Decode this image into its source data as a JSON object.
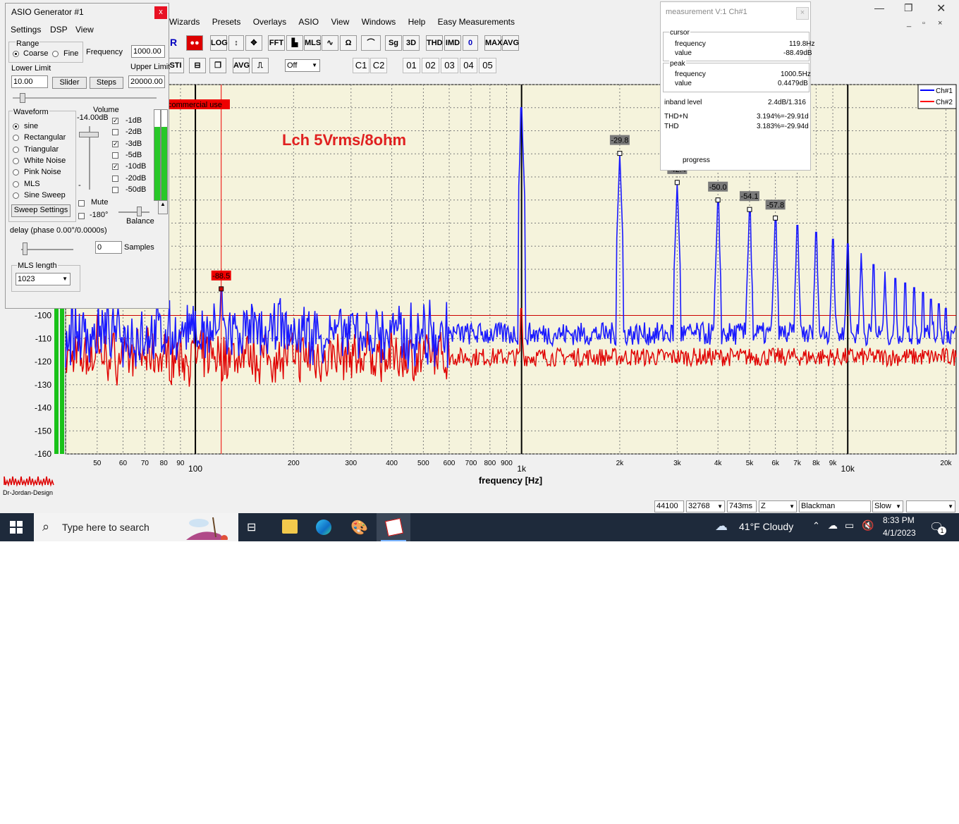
{
  "app": {
    "menus": [
      "Wizards",
      "Presets",
      "Overlays",
      "ASIO",
      "View",
      "Windows",
      "Help",
      "Easy Measurements"
    ],
    "toolbar1": [
      "R",
      "LOG",
      "↕",
      "✥",
      "FFT",
      "▙",
      "MLS",
      "∿",
      "Ω",
      "⌒",
      "Sg",
      "3D",
      "THD",
      "IMD",
      "0",
      "MAX",
      "AVG"
    ],
    "toolbar2": [
      "STI",
      "⊟",
      "❐",
      "AVG",
      "⎍"
    ],
    "toolbar2_select": "Off",
    "channels": [
      "C1",
      "C2"
    ],
    "presets": [
      "01",
      "02",
      "03",
      "04",
      "05"
    ],
    "win_controls": [
      "—",
      "❐",
      "✕"
    ],
    "sub_controls": [
      "_",
      "▫",
      "×"
    ]
  },
  "chart_data": {
    "type": "line",
    "title": "Lch 5Vrms/8ohm",
    "xlabel": "frequency [Hz]",
    "ylabel": "",
    "x_scale": "log",
    "xlim": [
      40,
      21500
    ],
    "ylim": [
      -160,
      0
    ],
    "x_tick_labels": [
      {
        "v": 50,
        "t": "50"
      },
      {
        "v": 60,
        "t": "60"
      },
      {
        "v": 70,
        "t": "70"
      },
      {
        "v": 80,
        "t": "80"
      },
      {
        "v": 90,
        "t": "90"
      },
      {
        "v": 100,
        "t": "100",
        "major": true
      },
      {
        "v": 200,
        "t": "200"
      },
      {
        "v": 300,
        "t": "300"
      },
      {
        "v": 400,
        "t": "400"
      },
      {
        "v": 500,
        "t": "500"
      },
      {
        "v": 600,
        "t": "600"
      },
      {
        "v": 700,
        "t": "700"
      },
      {
        "v": 800,
        "t": "800"
      },
      {
        "v": 900,
        "t": "900"
      },
      {
        "v": 1000,
        "t": "1k",
        "major": true
      },
      {
        "v": 2000,
        "t": "2k"
      },
      {
        "v": 3000,
        "t": "3k"
      },
      {
        "v": 4000,
        "t": "4k"
      },
      {
        "v": 5000,
        "t": "5k"
      },
      {
        "v": 6000,
        "t": "6k"
      },
      {
        "v": 7000,
        "t": "7k"
      },
      {
        "v": 8000,
        "t": "8k"
      },
      {
        "v": 9000,
        "t": "9k"
      },
      {
        "v": 10000,
        "t": "10k",
        "major": true
      },
      {
        "v": 20000,
        "t": "20k"
      }
    ],
    "y_tick_labels": [
      -100,
      -110,
      -120,
      -130,
      -140,
      -150,
      -160
    ],
    "grid": true,
    "legend": {
      "placement": "top-right",
      "entries": [
        {
          "name": "Ch#1",
          "color": "#0000ff"
        },
        {
          "name": "Ch#2",
          "color": "#ff0000"
        }
      ]
    },
    "series": [
      {
        "name": "Ch#1",
        "color": "#1a1aff",
        "peaks": [
          [
            100,
            -98
          ],
          [
            120,
            -88.5
          ],
          [
            180,
            -95
          ],
          [
            300,
            -100
          ],
          [
            1000,
            -10
          ],
          [
            2000,
            -29.8
          ],
          [
            3000,
            -42.4
          ],
          [
            4000,
            -50.0
          ],
          [
            5000,
            -54.1
          ],
          [
            6000,
            -57.8
          ],
          [
            7000,
            -61
          ],
          [
            8000,
            -64
          ],
          [
            9000,
            -67
          ],
          [
            10000,
            -69
          ],
          [
            11000,
            -73
          ],
          [
            12000,
            -78
          ],
          [
            13000,
            -81
          ],
          [
            14000,
            -84
          ],
          [
            15000,
            -86
          ],
          [
            16000,
            -88
          ],
          [
            17000,
            -90
          ],
          [
            18000,
            -93
          ],
          [
            19000,
            -95
          ],
          [
            20000,
            -97
          ]
        ],
        "noise_floor": -108
      },
      {
        "name": "Ch#2",
        "color": "#e00000",
        "noise_floor": -118,
        "peaks": [
          [
            50,
            -100
          ],
          [
            1000,
            -97
          ]
        ]
      }
    ],
    "markers": [
      {
        "freq": 2000,
        "db": -29.8,
        "label": "-29.8"
      },
      {
        "freq": 3000,
        "db": -42.4,
        "label": "-42.4"
      },
      {
        "freq": 4000,
        "db": -50.0,
        "label": "-50.0"
      },
      {
        "freq": 5000,
        "db": -54.1,
        "label": "-54.1"
      },
      {
        "freq": 6000,
        "db": -57.8,
        "label": "-57.8"
      },
      {
        "freq": 120,
        "db": -88.5,
        "label": "-88.5",
        "cursor": true
      }
    ],
    "reference_line_db": -100,
    "overlay_text": "commercial use",
    "logo_text": "Dr-Jordan-Design"
  },
  "status": {
    "sample_rate": "44100",
    "fft_size": "32768",
    "duration": "743ms",
    "zoom": "Z",
    "window": "Blackman",
    "speed": "Slow",
    "empty": ""
  },
  "generator": {
    "title": "ASIO Generator #1",
    "close": "x",
    "menus": [
      "Settings",
      "DSP",
      "View"
    ],
    "range_label": "Range",
    "coarse": "Coarse",
    "fine": "Fine",
    "frequency_label": "Frequency",
    "frequency_value": "1000.00",
    "lower_limit_label": "Lower Limit",
    "lower_limit_value": "10.00",
    "upper_limit_label": "Upper Limit",
    "upper_limit_value": "20000.00",
    "slider_btn": "Slider",
    "steps_btn": "Steps",
    "waveform_label": "Waveform",
    "waveforms": [
      "sine",
      "Rectangular",
      "Triangular",
      "White Noise",
      "Pink Noise",
      "MLS",
      "Sine Sweep"
    ],
    "selected_waveform": "sine",
    "sweep_settings": "Sweep Settings",
    "volume_label": "Volume",
    "volume_value": "-14.00dB",
    "volume_minus": "-",
    "attenuators": [
      {
        "label": "-1dB",
        "checked": true
      },
      {
        "label": "-2dB",
        "checked": false
      },
      {
        "label": "-3dB",
        "checked": true
      },
      {
        "label": "-5dB",
        "checked": false
      },
      {
        "label": "-10dB",
        "checked": true
      },
      {
        "label": "-20dB",
        "checked": false
      },
      {
        "label": "-50dB",
        "checked": false
      }
    ],
    "mute": "Mute",
    "phase180": "-180°",
    "balance": "Balance",
    "delay_label": "delay (phase  0.00°/0.0000s)",
    "samples_value": "0",
    "samples_label": "Samples",
    "mls_length_label": "MLS length",
    "mls_length_value": "1023"
  },
  "measurement": {
    "title": "measurement V:1 Ch#1",
    "close": "×",
    "cursor_label": "cursor",
    "cursor_freq_label": "frequency",
    "cursor_freq": "119.8Hz",
    "cursor_val_label": "value",
    "cursor_val": "-88.49dB",
    "peak_label": "peak",
    "peak_freq_label": "frequency",
    "peak_freq": "1000.5Hz",
    "peak_val_label": "value",
    "peak_val": "0.4479dB",
    "inband_label": "inband level",
    "inband_val": "2.4dB/1.316",
    "thdn_label": "THD+N",
    "thdn_val": "3.194%=-29.91d",
    "thd_label": "THD",
    "thd_val": "3.183%=-29.94d",
    "progress_label": "progress"
  },
  "taskbar": {
    "search_placeholder": "Type here to search",
    "weather": "41°F  Cloudy",
    "time": "8:33 PM",
    "date": "4/1/2023",
    "notifications": "1"
  }
}
